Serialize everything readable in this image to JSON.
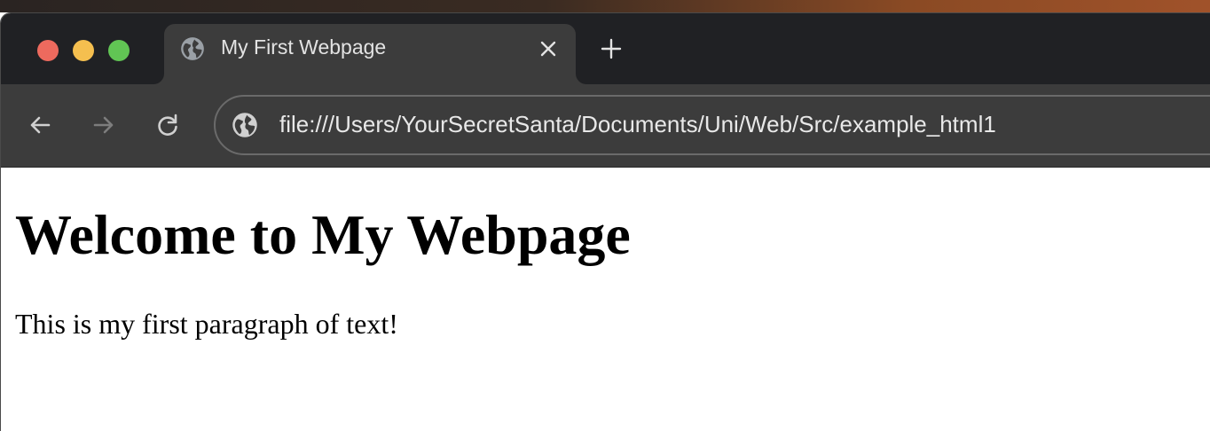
{
  "browser": {
    "tab": {
      "title": "My First Webpage",
      "favicon": "globe-icon"
    },
    "toolbar": {
      "url": "file:///Users/YourSecretSanta/Documents/Uni/Web/Src/example_html1",
      "back_icon": "arrow-left-icon",
      "forward_icon": "arrow-right-icon",
      "reload_icon": "reload-icon",
      "site_info_icon": "globe-icon"
    },
    "window_controls": {
      "close_color": "#ed6a5e",
      "minimize_color": "#f5bf4f",
      "maximize_color": "#61c554"
    }
  },
  "page": {
    "heading": "Welcome to My Webpage",
    "paragraph": "This is my first paragraph of text!"
  }
}
